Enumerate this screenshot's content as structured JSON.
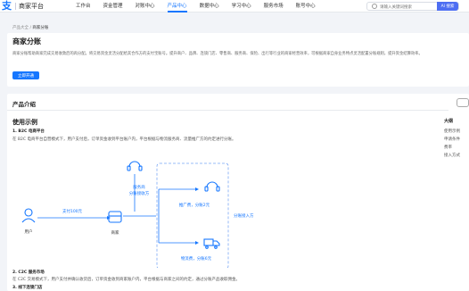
{
  "header": {
    "logo_mark": "支",
    "logo_text": "商家平台",
    "nav": [
      "工作台",
      "资金管理",
      "对账中心",
      "产品中心",
      "数据中心",
      "学习中心",
      "服务市场",
      "账号中心"
    ],
    "active_nav": "产品中心",
    "search_placeholder": "请输入关键词搜索",
    "search_button": "AI 搜索"
  },
  "breadcrumb": {
    "root": "产品大全",
    "sep": "/",
    "current": "商家分账"
  },
  "hero": {
    "title": "商家分账",
    "description": "商家分账帮助商家完成交易收款后的再分配。将交易资金灵活分配给其合作方的支付宝账号。提升商户、品牌、连锁门店、零售商、服务商、保险、出行等行业的商家经营效率，可根据商家自身业务特点灵活配置分账规则，提升资金结算效率。",
    "button": "立即开通"
  },
  "main": {
    "intro_title": "产品介绍",
    "usage_title": "使用示例",
    "case1_title": "1. B2C 电商平台",
    "case1_desc": "在 B2C 电商平台自营模式下，用户支付后，订单资金收到平台账户内，平台根据与物流服务商、流量推广方的约定进行分账。",
    "case2_title": "2. C2C 服务市场",
    "case2_desc": "在 C2C 交易模式下，用户支付并确认收货后，订单资金收到商家账户内，平台根据与商家之间的约定，通过分账产品收取佣金。",
    "case3_title": "3. 线下连锁门店"
  },
  "diagram": {
    "user_label": "用户",
    "merchant_label": "商家",
    "service_label_1": "服务商",
    "service_label_2": "分账接收方",
    "pay_label": "支付100元",
    "promo_label": "推广费，分账2元",
    "logistics_label": "物流费，分账6元",
    "receiver_label": "分账接入方"
  },
  "toc": {
    "title": "大纲",
    "items": [
      "使用示例",
      "申请条件",
      "费率",
      "接入方式"
    ]
  },
  "colors": {
    "accent": "#1677ff",
    "search_btn": "#4e6ef2",
    "bg": "#f2f4f8"
  }
}
